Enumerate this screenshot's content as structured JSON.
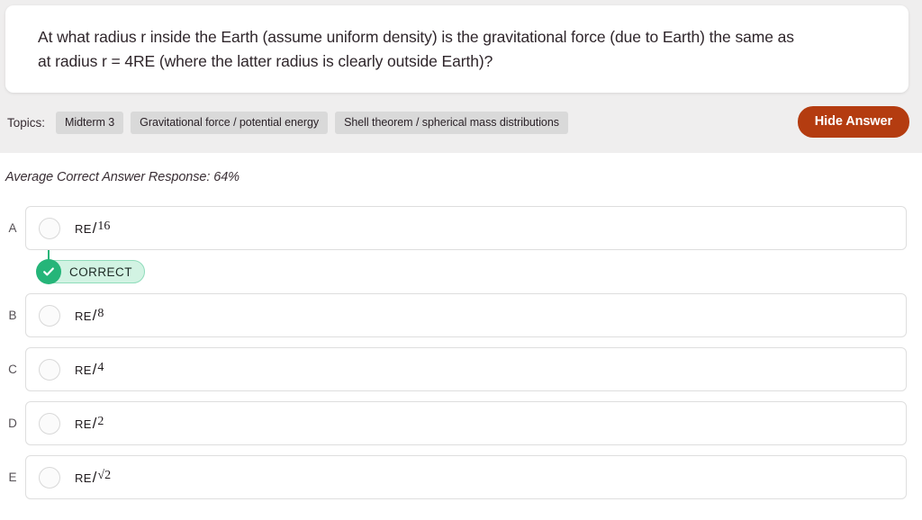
{
  "question": {
    "text": "At what radius r inside the Earth (assume uniform density) is the gravitational force (due to Earth) the same as at radius r = 4RE (where the latter radius is clearly outside Earth)?"
  },
  "topics": {
    "label": "Topics:",
    "tags": [
      "Midterm 3",
      "Gravitational force / potential energy",
      "Shell theorem / spherical mass distributions"
    ]
  },
  "toolbar": {
    "hide_answer_label": "Hide Answer",
    "hide_answer_color": "#b43c10"
  },
  "stats": {
    "average_correct_label": "Average Correct Answer Response: 64%",
    "average_correct_percent": "64%"
  },
  "answer_badge": {
    "label": "CORRECT",
    "check_icon": "check-icon",
    "accent_color": "#25b579",
    "pill_background": "#d2f3e3"
  },
  "options": [
    {
      "letter": "A",
      "base": "RE",
      "slash": "/",
      "denominator": "16",
      "radical": false,
      "correct": true
    },
    {
      "letter": "B",
      "base": "RE",
      "slash": "/",
      "denominator": "8",
      "radical": false,
      "correct": false
    },
    {
      "letter": "C",
      "base": "RE",
      "slash": "/",
      "denominator": "4",
      "radical": false,
      "correct": false
    },
    {
      "letter": "D",
      "base": "RE",
      "slash": "/",
      "denominator": "2",
      "radical": false,
      "correct": false
    },
    {
      "letter": "E",
      "base": "RE",
      "slash": "/",
      "denominator": "√2",
      "radical": true,
      "correct": false
    }
  ]
}
